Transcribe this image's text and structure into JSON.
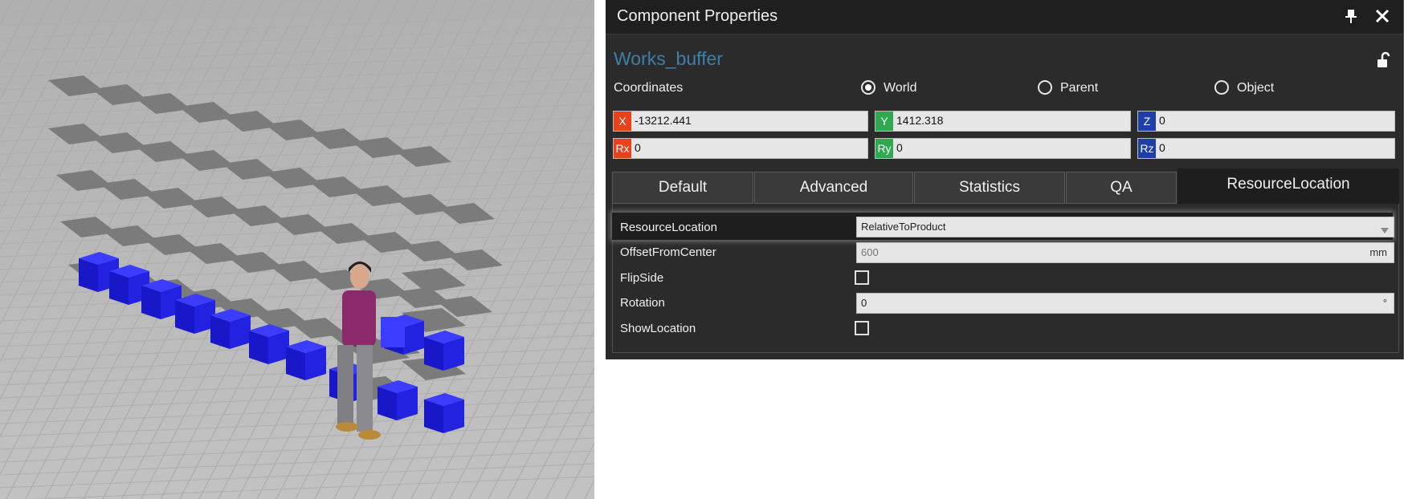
{
  "panel": {
    "title": "Component Properties",
    "pin_icon": "pin-icon",
    "close_icon": "close-icon",
    "component_name": "Works_buffer",
    "lock_icon": "unlock-icon"
  },
  "coordinates": {
    "label": "Coordinates",
    "options": [
      {
        "label": "World",
        "checked": true
      },
      {
        "label": "Parent",
        "checked": false
      },
      {
        "label": "Object",
        "checked": false
      }
    ],
    "fields": {
      "x": {
        "tag": "X",
        "value": "-13212.441",
        "color": "#e8421c"
      },
      "y": {
        "tag": "Y",
        "value": "1412.318",
        "color": "#2fa84f"
      },
      "z": {
        "tag": "Z",
        "value": "0",
        "color": "#1f3fa8"
      },
      "rx": {
        "tag": "Rx",
        "value": "0",
        "color": "#e8421c"
      },
      "ry": {
        "tag": "Ry",
        "value": "0",
        "color": "#2fa84f"
      },
      "rz": {
        "tag": "Rz",
        "value": "0",
        "color": "#1f3fa8"
      }
    }
  },
  "tabs": [
    {
      "label": "Default",
      "active": false
    },
    {
      "label": "Advanced",
      "active": false
    },
    {
      "label": "Statistics",
      "active": false
    },
    {
      "label": "QA",
      "active": false
    },
    {
      "label": "ResourceLocation",
      "active": true
    }
  ],
  "properties": {
    "resource_location": {
      "label": "ResourceLocation",
      "value": "RelativeToProduct"
    },
    "offset_from_center": {
      "label": "OffsetFromCenter",
      "value": "600",
      "unit": "mm"
    },
    "flip_side": {
      "label": "FlipSide",
      "checked": false
    },
    "rotation": {
      "label": "Rotation",
      "value": "0",
      "unit": "°"
    },
    "show_location": {
      "label": "ShowLocation",
      "checked": false
    }
  }
}
